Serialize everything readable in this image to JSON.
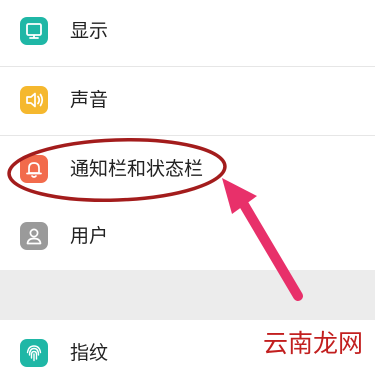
{
  "settings": {
    "items": [
      {
        "label": "显示",
        "icon": "display-icon",
        "color": "#1fb7a6"
      },
      {
        "label": "声音",
        "icon": "speaker-icon",
        "color": "#f5b82e"
      },
      {
        "label": "通知栏和状态栏",
        "icon": "bell-icon",
        "color": "#f26b4c"
      },
      {
        "label": "用户",
        "icon": "user-icon",
        "color": "#9a9a9a"
      },
      {
        "label": "指纹",
        "icon": "fingerprint-icon",
        "color": "#1fb7a6"
      }
    ]
  },
  "annotation": {
    "ellipse_color": "#a31c1c",
    "arrow_color": "#e8306a"
  },
  "watermark": {
    "text": "云南龙网",
    "color": "#c21f1f"
  }
}
